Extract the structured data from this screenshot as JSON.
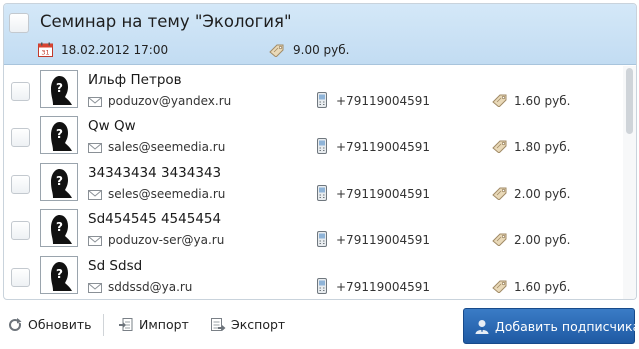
{
  "event": {
    "title": "Семинар на тему \"Экология\"",
    "date": "18.02.2012 17:00",
    "price": "9.00 руб."
  },
  "subscribers": [
    {
      "name": "Ильф Петров",
      "email": "poduzov@yandex.ru",
      "phone": "+79119004591",
      "price": "1.60 руб."
    },
    {
      "name": "Qw Qw",
      "email": "sales@seemedia.ru",
      "phone": "+79119004591",
      "price": "1.80 руб."
    },
    {
      "name": "34343434 3434343",
      "email": "seles@seemedia.ru",
      "phone": "+79119004591",
      "price": "2.00 руб."
    },
    {
      "name": "Sd454545 4545454",
      "email": "poduzov-ser@ya.ru",
      "phone": "+79119004591",
      "price": "2.00 руб."
    },
    {
      "name": "Sd Sdsd",
      "email": "sddssd@ya.ru",
      "phone": "+79119004591",
      "price": "1.60 руб."
    }
  ],
  "toolbar": {
    "refresh_label": "Обновить",
    "import_label": "Импорт",
    "export_label": "Экспорт",
    "add_subscriber_label": "Добавить подписчика"
  },
  "colors": {
    "header_bg": "#c8e0f4",
    "primary_button": "#2b6ab5",
    "icon_gray": "#8a9096"
  }
}
